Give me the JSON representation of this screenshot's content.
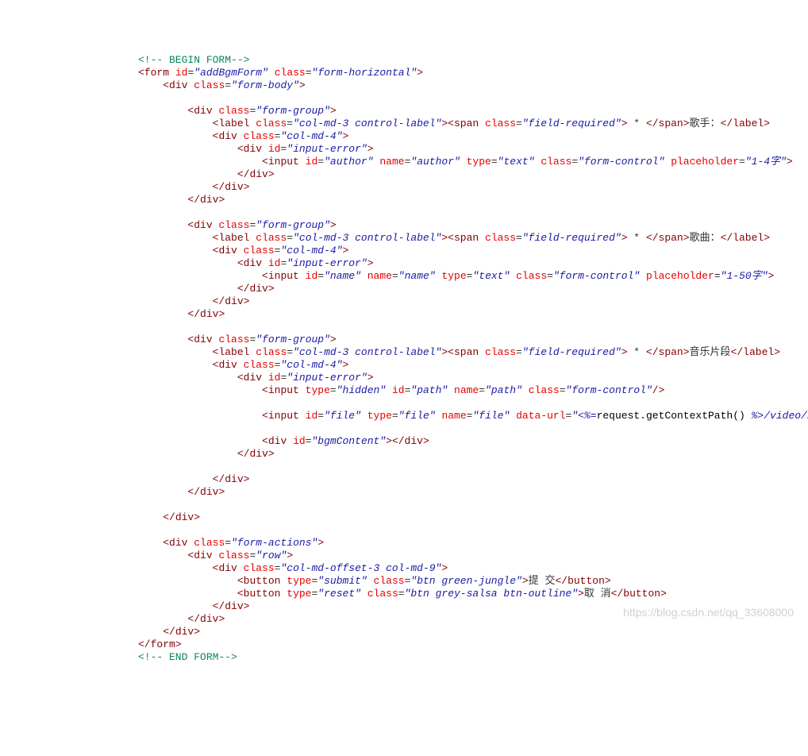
{
  "comment_begin": "<!-- BEGIN FORM-->",
  "comment_end": "<!-- END FORM-->",
  "form_id": "addBgmForm",
  "form_class": "form-horizontal",
  "body_class": "form-body",
  "group_class": "form-group",
  "label_class": "col-md-3 control-label",
  "req_class": "field-required",
  "req_text": " * ",
  "col4": "col-md-4",
  "err_id": "input-error",
  "ctrl_class": "form-control",
  "labels": {
    "author": "歌手：",
    "name": "歌曲：",
    "file": "音乐片段"
  },
  "author": {
    "id": "author",
    "name": "author",
    "type": "text",
    "ph": "1-4字"
  },
  "song": {
    "id": "name",
    "name": "name",
    "type": "text",
    "ph": "1-50字"
  },
  "hidden": {
    "type": "hidden",
    "id": "path",
    "name": "path"
  },
  "file": {
    "id": "file",
    "type": "file",
    "name": "file",
    "dataurl_attr": "data-url"
  },
  "ctxcall": "request.getContextPath() ",
  "ctxtail": "/video/bgmUploa",
  "open_scriptlet": "<%=",
  "close_scriptlet": "%>",
  "bgm_content_id": "bgmContent",
  "actions_class": "form-actions",
  "row_class": "row",
  "actions_cols": "col-md-offset-3 col-md-9",
  "submit": {
    "type": "submit",
    "class": "btn green-jungle",
    "text": "提 交"
  },
  "reset": {
    "type": "reset",
    "class": "btn grey-salsa btn-outline",
    "text": "取 消"
  },
  "watermark": "https://blog.csdn.net/qq_33608000"
}
